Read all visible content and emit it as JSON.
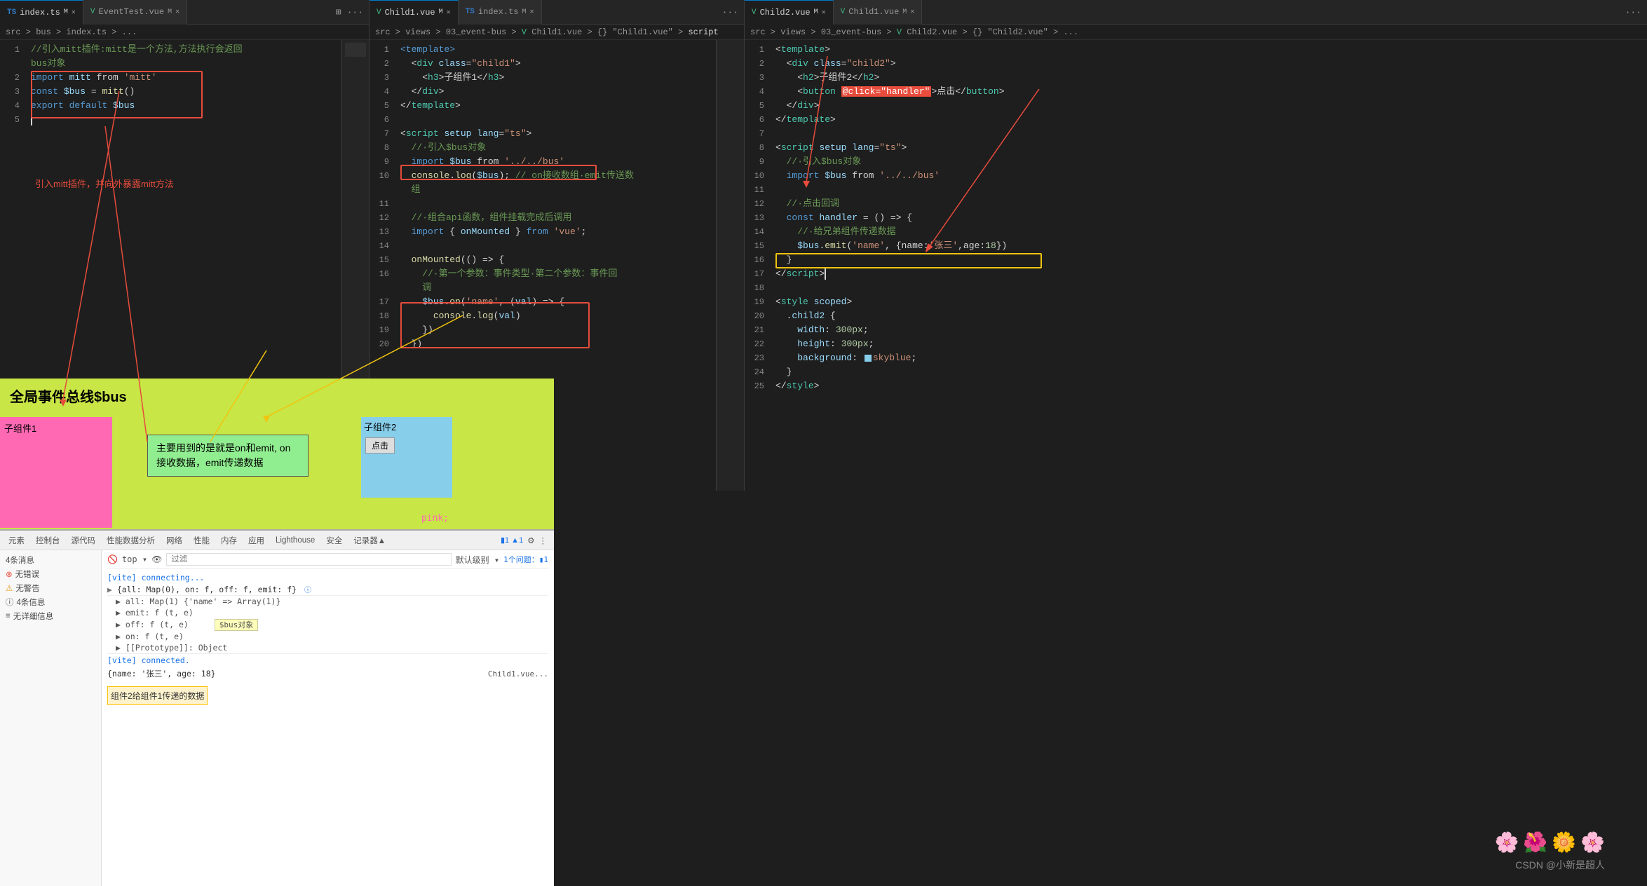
{
  "tabs_left": {
    "items": [
      {
        "label": "index.ts",
        "type": "ts",
        "active": true,
        "modified": true,
        "id": "index-ts"
      },
      {
        "label": "EventTest.vue",
        "type": "vue",
        "active": false,
        "modified": true,
        "id": "event-test-vue"
      }
    ]
  },
  "tabs_middle": {
    "items": [
      {
        "label": "Child1.vue",
        "type": "vue",
        "active": true,
        "modified": true,
        "id": "child1-vue"
      },
      {
        "label": "index.ts",
        "type": "ts",
        "active": false,
        "modified": true,
        "id": "index-ts-mid"
      }
    ]
  },
  "tabs_right": {
    "items": [
      {
        "label": "Child2.vue",
        "type": "vue",
        "active": true,
        "modified": true,
        "id": "child2-vue"
      },
      {
        "label": "Child1.vue",
        "type": "vue",
        "active": false,
        "modified": true,
        "id": "child1-vue-right"
      }
    ]
  },
  "breadcrumb_left": "src > bus > index.ts > ...",
  "breadcrumb_middle": "src > views > 03_event-bus > Child1.vue > {} \"Child1.vue\" > script",
  "breadcrumb_right": "src > views > 03_event-bus > Child2.vue > {} \"Child2.vue\" > ...",
  "left_code": [
    {
      "num": 1,
      "text": "//引入mitt插件:mitt是一个方法,方法执行会返回"
    },
    {
      "num": "",
      "text": "bus对象"
    },
    {
      "num": 2,
      "text": "import mitt from 'mitt'"
    },
    {
      "num": 3,
      "text": "const $bus = mitt()"
    },
    {
      "num": 4,
      "text": "export default $bus"
    },
    {
      "num": 5,
      "text": ""
    }
  ],
  "left_annotation": "引入mitt插件，并向外暴露mitt方法",
  "middle_code_lines": 20,
  "right_code_lines": 25,
  "preview": {
    "title": "全局事件总线$bus",
    "child1_label": "子组件1",
    "child2_label": "子组件2",
    "child2_button": "点击"
  },
  "annotation_main": "主要用到的是就是on和emit,\non接收数据，emit传递数据",
  "devtools": {
    "tabs": [
      "元素",
      "控制台",
      "源代码",
      "性能数据分析",
      "网络",
      "性能",
      "内存",
      "应用",
      "Lighthouse",
      "安全",
      "记录器"
    ],
    "active_tab": "控制台",
    "filter_label": "过滤",
    "top_dropdown": "top",
    "log1": "[vite] connecting...",
    "log2_prefix": "{all: Map(0), on: f, off: f, emit: f}",
    "log3": "▶ all: Map(1) {'name' => Array(1)}",
    "log4": "▶ emit: f (t, e)",
    "log5": "▶ off: f (t, e)",
    "log6": "▶ on: f (t, e)",
    "log7": "▶ [[Prototype]]: Object",
    "log8": "[vite] connected.",
    "log9": "{name: '张三', age: 18}",
    "bus_label": "$bus对象",
    "sidebar_items": [
      {
        "label": "4条消息",
        "type": "normal"
      },
      {
        "label": "无错误",
        "type": "normal"
      },
      {
        "label": "无警告",
        "type": "normal"
      },
      {
        "label": "4条信息",
        "type": "normal"
      },
      {
        "label": "无详细信息",
        "type": "normal"
      }
    ],
    "bottom_annotation": "组件2给组件1传递的数据"
  },
  "csdn": {
    "text": "CSDN @小新是超人"
  }
}
